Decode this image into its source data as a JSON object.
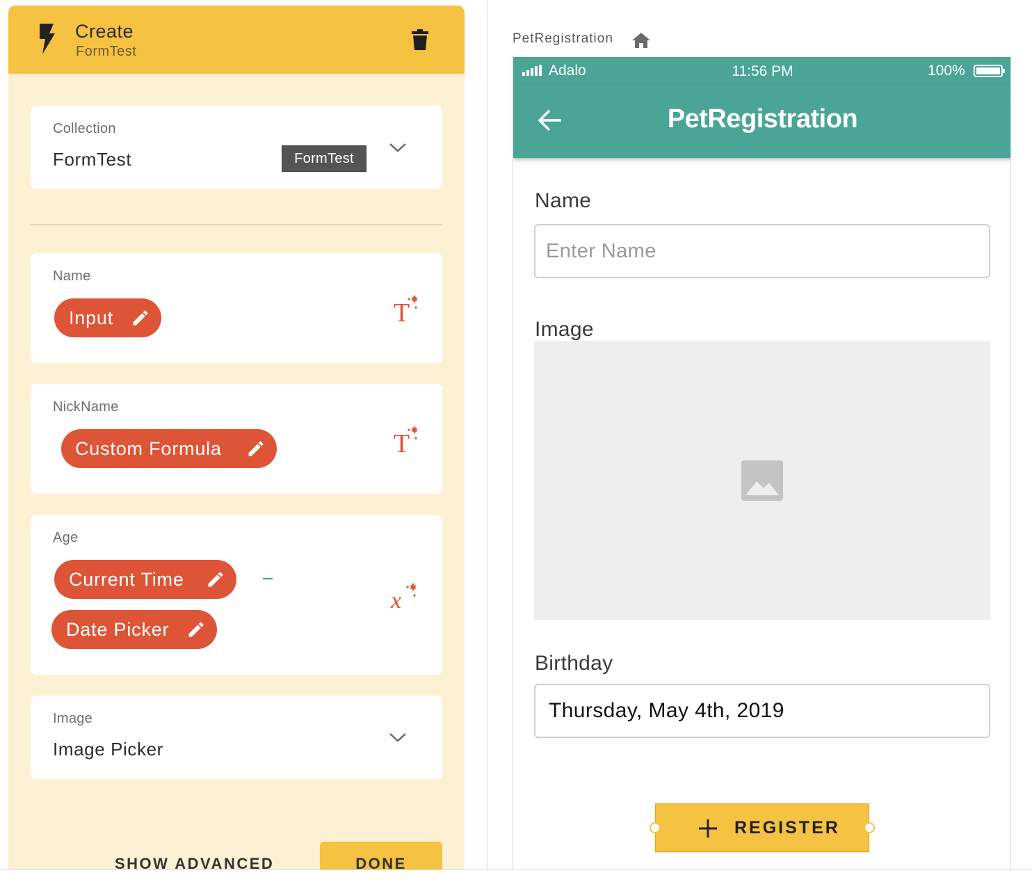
{
  "left_panel": {
    "header": {
      "title": "Create",
      "subtitle": "FormTest"
    },
    "collection": {
      "label": "Collection",
      "value": "FormTest",
      "tooltip": "FormTest"
    },
    "fields": [
      {
        "label": "Name",
        "chips": [
          "Input"
        ],
        "icon": "magic-text-icon"
      },
      {
        "label": "NickName",
        "chips": [
          "Custom Formula"
        ],
        "icon": "magic-text-icon"
      },
      {
        "label": "Age",
        "chips": [
          "Current Time",
          "Date Picker"
        ],
        "operator": "-",
        "icon": "magic-formula-icon"
      },
      {
        "label": "Image",
        "value": "Image Picker"
      }
    ],
    "footer": {
      "show_advanced": "SHOW ADVANCED",
      "done": "DONE"
    }
  },
  "preview": {
    "screen_name": "PetRegistration",
    "status_bar": {
      "carrier": "Adalo",
      "time": "11:56 PM",
      "battery": "100%"
    },
    "app_bar": {
      "title": "PetRegistration"
    },
    "form": {
      "name_label": "Name",
      "name_placeholder": "Enter Name",
      "image_label": "Image",
      "birthday_label": "Birthday",
      "birthday_value": "Thursday, May 4th, 2019",
      "register_label": "REGISTER"
    }
  },
  "colors": {
    "panel_background": "#fdf1d3",
    "accent_yellow": "#f5c242",
    "chip_red": "#de5437",
    "app_teal": "#4aa596"
  }
}
